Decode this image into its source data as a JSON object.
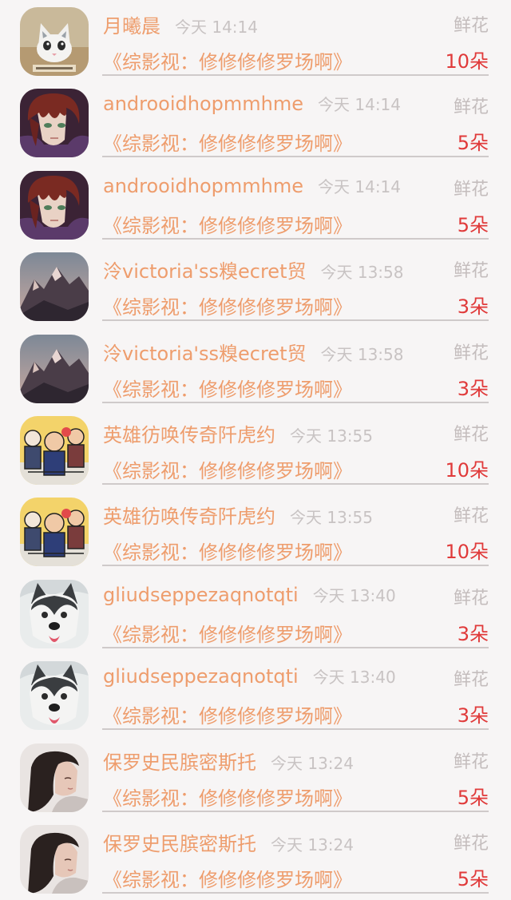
{
  "rows": [
    {
      "name": "月曦晨",
      "time": "今天 14:14",
      "gift": "鲜花",
      "work": "《综影视：修修修修罗场啊》",
      "count": "10朵",
      "avatar": "cat"
    },
    {
      "name": "androoidhopmmhme",
      "time": "今天 14:14",
      "gift": "鲜花",
      "work": "《综影视：修修修修罗场啊》",
      "count": "5朵",
      "avatar": "anime-boy"
    },
    {
      "name": "androoidhopmmhme",
      "time": "今天 14:14",
      "gift": "鲜花",
      "work": "《综影视：修修修修罗场啊》",
      "count": "5朵",
      "avatar": "anime-boy"
    },
    {
      "name": "泠victoria'ss糗ecret贸",
      "time": "今天 13:58",
      "gift": "鲜花",
      "work": "《综影视：修修修修罗场啊》",
      "count": "3朵",
      "avatar": "mountain"
    },
    {
      "name": "泠victoria'ss糗ecret贸",
      "time": "今天 13:58",
      "gift": "鲜花",
      "work": "《综影视：修修修修罗场啊》",
      "count": "3朵",
      "avatar": "mountain"
    },
    {
      "name": "英雄彷唤传奇阡虎约",
      "time": "今天 13:55",
      "gift": "鲜花",
      "work": "《综影视：修修修修罗场啊》",
      "count": "10朵",
      "avatar": "cartoon"
    },
    {
      "name": "英雄彷唤传奇阡虎约",
      "time": "今天 13:55",
      "gift": "鲜花",
      "work": "《综影视：修修修修罗场啊》",
      "count": "10朵",
      "avatar": "cartoon"
    },
    {
      "name": "gliudseppezaqnotqti",
      "time": "今天 13:40",
      "gift": "鲜花",
      "work": "《综影视：修修修修罗场啊》",
      "count": "3朵",
      "avatar": "husky"
    },
    {
      "name": "gliudseppezaqnotqti",
      "time": "今天 13:40",
      "gift": "鲜花",
      "work": "《综影视：修修修修罗场啊》",
      "count": "3朵",
      "avatar": "husky"
    },
    {
      "name": "保罗史民膑密斯托",
      "time": "今天 13:24",
      "gift": "鲜花",
      "work": "《综影视：修修修修罗场啊》",
      "count": "5朵",
      "avatar": "girl"
    },
    {
      "name": "保罗史民膑密斯托",
      "time": "今天 13:24",
      "gift": "鲜花",
      "work": "《综影视：修修修修罗场啊》",
      "count": "5朵",
      "avatar": "girl"
    }
  ]
}
